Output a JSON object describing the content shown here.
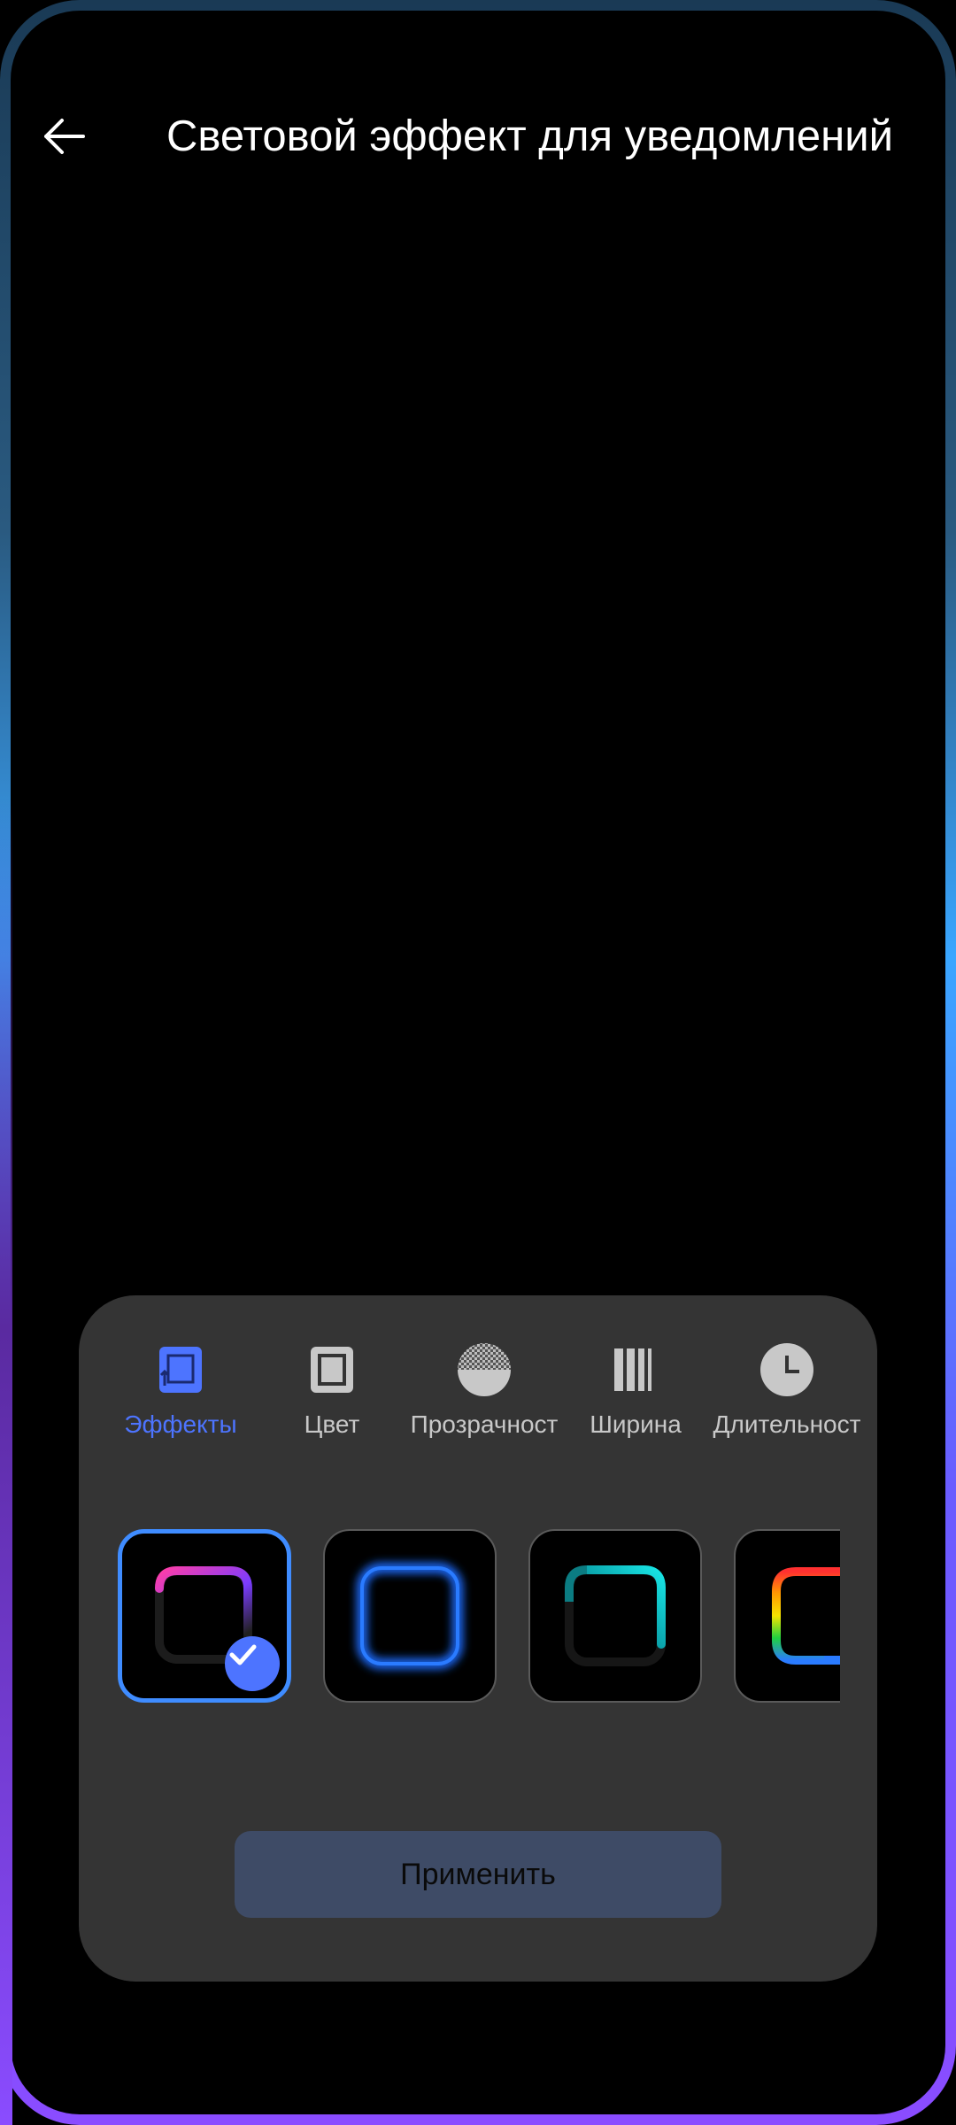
{
  "header": {
    "title": "Световой эффект для уведомлений",
    "back_icon": "arrow-left-icon"
  },
  "tabs": [
    {
      "label": "Эффекты",
      "icon": "effects-icon",
      "active": true
    },
    {
      "label": "Цвет",
      "icon": "color-icon",
      "active": false
    },
    {
      "label": "Прозрачност",
      "icon": "transparency-icon",
      "active": false
    },
    {
      "label": "Ширина",
      "icon": "width-icon",
      "active": false
    },
    {
      "label": "Длительност",
      "icon": "duration-icon",
      "active": false
    }
  ],
  "effects": [
    {
      "name": "effect-gradient-purple",
      "selected": true
    },
    {
      "name": "effect-blue-glow",
      "selected": false
    },
    {
      "name": "effect-cyan",
      "selected": false
    },
    {
      "name": "effect-rainbow",
      "selected": false
    }
  ],
  "apply_label": "Применить",
  "colors": {
    "accent": "#4d74ff",
    "panel": "#343434",
    "apply_bg": "#3e4b66",
    "selected_border": "#3f8cff"
  }
}
